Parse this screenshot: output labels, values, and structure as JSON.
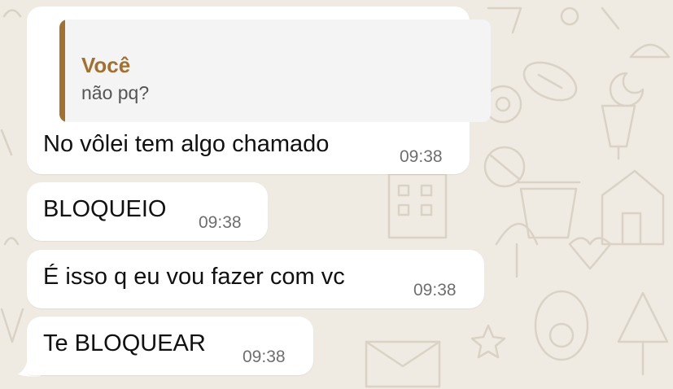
{
  "chat": {
    "background_color": "#efeae2",
    "accent_color": "#a3702e",
    "messages": [
      {
        "quote": {
          "author": "Você",
          "text": "não pq?"
        },
        "text": "No vôlei tem algo chamado",
        "time": "09:38"
      },
      {
        "text": "BLOQUEIO",
        "time": "09:38"
      },
      {
        "text": "É isso q eu vou fazer com vc",
        "time": "09:38"
      },
      {
        "text": "Te BLOQUEAR",
        "time": "09:38"
      }
    ]
  }
}
